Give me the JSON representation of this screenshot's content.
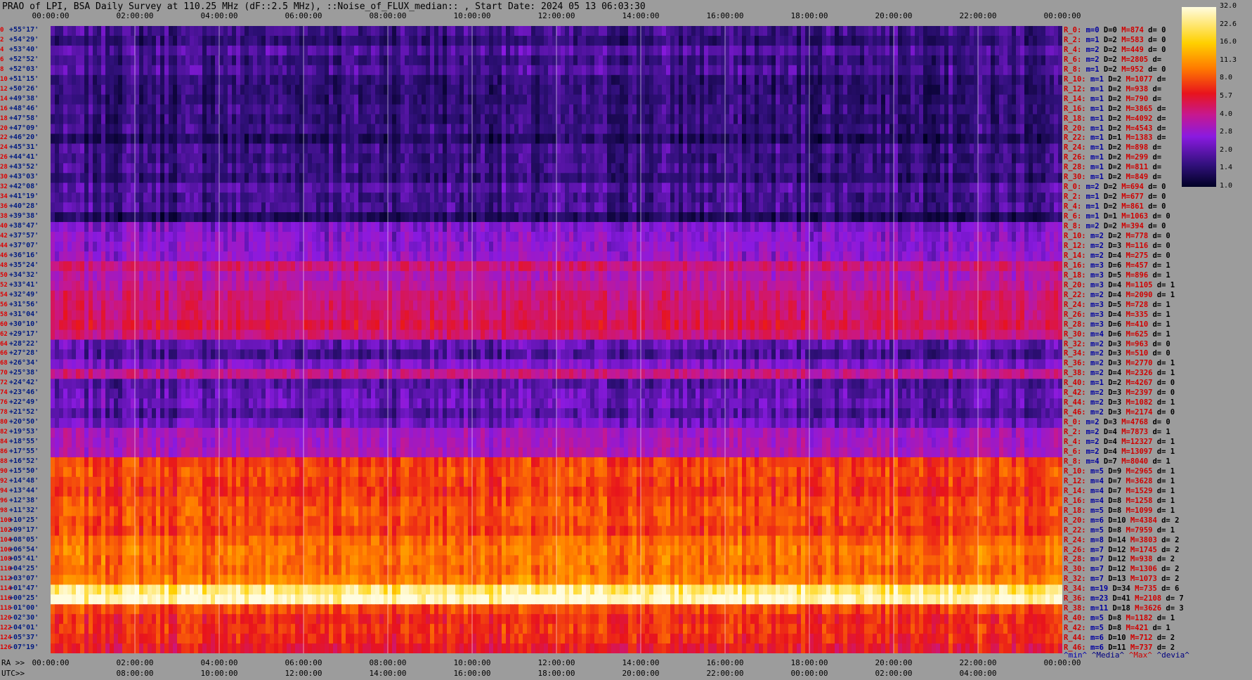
{
  "title": "PRAO of LPI, BSA Daily Survey at 110.25 MHz (dF::2.5 MHz), ::Noise_of_FLUX_median:: , Start Date: 2024 05 13 06:03:30",
  "axis_labels": {
    "ra": "RA >>",
    "utc": "UTC>>"
  },
  "top_ticks": [
    "00:00:00",
    "02:00:00",
    "04:00:00",
    "06:00:00",
    "08:00:00",
    "10:00:00",
    "12:00:00",
    "14:00:00",
    "16:00:00",
    "18:00:00",
    "20:00:00",
    "22:00:00",
    "00:00:00"
  ],
  "ra_ticks": [
    "00:00:00",
    "02:00:00",
    "04:00:00",
    "06:00:00",
    "08:00:00",
    "10:00:00",
    "12:00:00",
    "14:00:00",
    "16:00:00",
    "18:00:00",
    "20:00:00",
    "22:00:00",
    "00:00:00"
  ],
  "utc_ticks": [
    "08:00:00",
    "10:00:00",
    "12:00:00",
    "14:00:00",
    "16:00:00",
    "18:00:00",
    "20:00:00",
    "22:00:00",
    "00:00:00",
    "02:00:00",
    "04:00:00"
  ],
  "legend": {
    "min": "^min^",
    "median": "^Media^",
    "max": "^Max^",
    "dev": "^devia^"
  },
  "colorbar": {
    "ticks": [
      "32.0",
      "22.6",
      "16.0",
      "11.3",
      "8.0",
      "5.7",
      "4.0",
      "2.8",
      "2.0",
      "1.4",
      "1.0"
    ]
  },
  "chart_data": {
    "type": "heatmap",
    "colorscale": [
      "#000024",
      "#30107a",
      "#8a1ae0",
      "#c61890",
      "#e8141c",
      "#ff7b00",
      "#ffd000",
      "#fffce0"
    ],
    "value_range": [
      1.0,
      32.0
    ],
    "log_scale": true,
    "x_axis": "RA 00:00:00 – 24:00:00",
    "declinations": [
      {
        "i": "0",
        "d": "+55°17'"
      },
      {
        "i": "2",
        "d": "+54°29'"
      },
      {
        "i": "4",
        "d": "+53°40'"
      },
      {
        "i": "6",
        "d": "+52°52'"
      },
      {
        "i": "8",
        "d": "+52°03'"
      },
      {
        "i": "10",
        "d": "+51°15'"
      },
      {
        "i": "12",
        "d": "+50°26'"
      },
      {
        "i": "14",
        "d": "+49°38'"
      },
      {
        "i": "16",
        "d": "+48°46'"
      },
      {
        "i": "18",
        "d": "+47°58'"
      },
      {
        "i": "20",
        "d": "+47°09'"
      },
      {
        "i": "22",
        "d": "+46°20'"
      },
      {
        "i": "24",
        "d": "+45°31'"
      },
      {
        "i": "26",
        "d": "+44°41'"
      },
      {
        "i": "28",
        "d": "+43°52'"
      },
      {
        "i": "30",
        "d": "+43°03'"
      },
      {
        "i": "32",
        "d": "+42°08'"
      },
      {
        "i": "34",
        "d": "+41°19'"
      },
      {
        "i": "36",
        "d": "+40°28'"
      },
      {
        "i": "38",
        "d": "+39°38'"
      },
      {
        "i": "40",
        "d": "+38°47'"
      },
      {
        "i": "42",
        "d": "+37°57'"
      },
      {
        "i": "44",
        "d": "+37°07'"
      },
      {
        "i": "46",
        "d": "+36°16'"
      },
      {
        "i": "48",
        "d": "+35°24'"
      },
      {
        "i": "50",
        "d": "+34°32'"
      },
      {
        "i": "52",
        "d": "+33°41'"
      },
      {
        "i": "54",
        "d": "+32°49'"
      },
      {
        "i": "56",
        "d": "+31°56'"
      },
      {
        "i": "58",
        "d": "+31°04'"
      },
      {
        "i": "60",
        "d": "+30°10'"
      },
      {
        "i": "62",
        "d": "+29°17'"
      },
      {
        "i": "64",
        "d": "+28°22'"
      },
      {
        "i": "66",
        "d": "+27°28'"
      },
      {
        "i": "68",
        "d": "+26°34'"
      },
      {
        "i": "70",
        "d": "+25°38'"
      },
      {
        "i": "72",
        "d": "+24°42'"
      },
      {
        "i": "74",
        "d": "+23°46'"
      },
      {
        "i": "76",
        "d": "+22°49'"
      },
      {
        "i": "78",
        "d": "+21°52'"
      },
      {
        "i": "80",
        "d": "+20°50'"
      },
      {
        "i": "82",
        "d": "+19°53'"
      },
      {
        "i": "84",
        "d": "+18°55'"
      },
      {
        "i": "86",
        "d": "+17°55'"
      },
      {
        "i": "88",
        "d": "+16°52'"
      },
      {
        "i": "90",
        "d": "+15°50'"
      },
      {
        "i": "92",
        "d": "+14°48'"
      },
      {
        "i": "94",
        "d": "+13°44'"
      },
      {
        "i": "96",
        "d": "+12°38'"
      },
      {
        "i": "98",
        "d": "+11°32'"
      },
      {
        "i": "100",
        "d": "+10°25'"
      },
      {
        "i": "102",
        "d": "+09°17'"
      },
      {
        "i": "104",
        "d": "+08°05'"
      },
      {
        "i": "106",
        "d": "+06°54'"
      },
      {
        "i": "108",
        "d": "+05°41'"
      },
      {
        "i": "110",
        "d": "+04°25'"
      },
      {
        "i": "112",
        "d": "+03°07'"
      },
      {
        "i": "114",
        "d": "+01°47'"
      },
      {
        "i": "116",
        "d": "+00°25'"
      },
      {
        "i": "118",
        "d": "-01°00'"
      },
      {
        "i": "120",
        "d": "-02°30'"
      },
      {
        "i": "122",
        "d": "-04°01'"
      },
      {
        "i": "124",
        "d": "-05°37'"
      },
      {
        "i": "126",
        "d": "-07°19'"
      }
    ],
    "row_levels": [
      1.8,
      1.6,
      2.0,
      1.7,
      1.9,
      1.6,
      1.6,
      1.6,
      1.7,
      1.6,
      1.7,
      1.4,
      1.8,
      1.7,
      1.8,
      1.6,
      2.0,
      1.8,
      1.9,
      1.4,
      2.6,
      2.8,
      2.9,
      3.0,
      5.0,
      3.8,
      4.2,
      5.0,
      5.2,
      5.3,
      6.0,
      5.0,
      2.2,
      1.9,
      2.6,
      4.5,
      2.0,
      2.2,
      2.3,
      2.0,
      2.4,
      3.4,
      3.4,
      3.6,
      9.0,
      9.5,
      9.0,
      8.5,
      9.5,
      10.0,
      9.5,
      9.0,
      11.0,
      12.0,
      11.5,
      11.0,
      12.5,
      26.0,
      32.0,
      9.5,
      8.0,
      8.5,
      8.0,
      7.0
    ]
  },
  "stats": [
    {
      "r": "R_0:",
      "m": "m=0",
      "D": "D=0",
      "M": "M=874",
      "d": "d= 0"
    },
    {
      "r": "R_2:",
      "m": "m=1",
      "D": "D=2",
      "M": "M=583",
      "d": "d= 0"
    },
    {
      "r": "R_4:",
      "m": "m=2",
      "D": "D=2",
      "M": "M=449",
      "d": "d= 0"
    },
    {
      "r": "R_6:",
      "m": "m=2",
      "D": "D=2",
      "M": "M=2805",
      "d": "d="
    },
    {
      "r": "R_8:",
      "m": "m=1",
      "D": "D=2",
      "M": "M=952",
      "d": "d= 0"
    },
    {
      "r": "R_10:",
      "m": "m=1",
      "D": "D=2",
      "M": "M=1077",
      "d": "d="
    },
    {
      "r": "R_12:",
      "m": "m=1",
      "D": "D=2",
      "M": "M=938",
      "d": "d="
    },
    {
      "r": "R_14:",
      "m": "m=1",
      "D": "D=2",
      "M": "M=790",
      "d": "d="
    },
    {
      "r": "R_16:",
      "m": "m=1",
      "D": "D=2",
      "M": "M=3865",
      "d": "d="
    },
    {
      "r": "R_18:",
      "m": "m=1",
      "D": "D=2",
      "M": "M=4092",
      "d": "d="
    },
    {
      "r": "R_20:",
      "m": "m=1",
      "D": "D=2",
      "M": "M=4543",
      "d": "d="
    },
    {
      "r": "R_22:",
      "m": "m=1",
      "D": "D=1",
      "M": "M=1383",
      "d": "d="
    },
    {
      "r": "R_24:",
      "m": "m=1",
      "D": "D=2",
      "M": "M=898",
      "d": "d="
    },
    {
      "r": "R_26:",
      "m": "m=1",
      "D": "D=2",
      "M": "M=299",
      "d": "d="
    },
    {
      "r": "R_28:",
      "m": "m=1",
      "D": "D=2",
      "M": "M=811",
      "d": "d="
    },
    {
      "r": "R_30:",
      "m": "m=1",
      "D": "D=2",
      "M": "M=849",
      "d": "d="
    },
    {
      "r": "R_0:",
      "m": "m=2",
      "D": "D=2",
      "M": "M=694",
      "d": "d= 0"
    },
    {
      "r": "R_2:",
      "m": "m=1",
      "D": "D=2",
      "M": "M=677",
      "d": "d= 0"
    },
    {
      "r": "R_4:",
      "m": "m=1",
      "D": "D=2",
      "M": "M=861",
      "d": "d= 0"
    },
    {
      "r": "R_6:",
      "m": "m=1",
      "D": "D=1",
      "M": "M=1063",
      "d": "d= 0"
    },
    {
      "r": "R_8:",
      "m": "m=2",
      "D": "D=2",
      "M": "M=394",
      "d": "d= 0"
    },
    {
      "r": "R_10:",
      "m": "m=2",
      "D": "D=2",
      "M": "M=778",
      "d": "d= 0"
    },
    {
      "r": "R_12:",
      "m": "m=2",
      "D": "D=3",
      "M": "M=116",
      "d": "d= 0"
    },
    {
      "r": "R_14:",
      "m": "m=2",
      "D": "D=4",
      "M": "M=275",
      "d": "d= 0"
    },
    {
      "r": "R_16:",
      "m": "m=3",
      "D": "D=6",
      "M": "M=457",
      "d": "d= 1"
    },
    {
      "r": "R_18:",
      "m": "m=3",
      "D": "D=5",
      "M": "M=896",
      "d": "d= 1"
    },
    {
      "r": "R_20:",
      "m": "m=3",
      "D": "D=4",
      "M": "M=1105",
      "d": "d= 1"
    },
    {
      "r": "R_22:",
      "m": "m=2",
      "D": "D=4",
      "M": "M=2090",
      "d": "d= 1"
    },
    {
      "r": "R_24:",
      "m": "m=3",
      "D": "D=5",
      "M": "M=728",
      "d": "d= 1"
    },
    {
      "r": "R_26:",
      "m": "m=3",
      "D": "D=4",
      "M": "M=335",
      "d": "d= 1"
    },
    {
      "r": "R_28:",
      "m": "m=3",
      "D": "D=6",
      "M": "M=410",
      "d": "d= 1"
    },
    {
      "r": "R_30:",
      "m": "m=4",
      "D": "D=6",
      "M": "M=625",
      "d": "d= 1"
    },
    {
      "r": "R_32:",
      "m": "m=2",
      "D": "D=3",
      "M": "M=963",
      "d": "d= 0"
    },
    {
      "r": "R_34:",
      "m": "m=2",
      "D": "D=3",
      "M": "M=510",
      "d": "d= 0"
    },
    {
      "r": "R_36:",
      "m": "m=2",
      "D": "D=3",
      "M": "M=2770",
      "d": "d= 1"
    },
    {
      "r": "R_38:",
      "m": "m=2",
      "D": "D=4",
      "M": "M=2326",
      "d": "d= 1"
    },
    {
      "r": "R_40:",
      "m": "m=1",
      "D": "D=2",
      "M": "M=4267",
      "d": "d= 0"
    },
    {
      "r": "R_42:",
      "m": "m=2",
      "D": "D=3",
      "M": "M=2397",
      "d": "d= 0"
    },
    {
      "r": "R_44:",
      "m": "m=2",
      "D": "D=3",
      "M": "M=1082",
      "d": "d= 1"
    },
    {
      "r": "R_46:",
      "m": "m=2",
      "D": "D=3",
      "M": "M=2174",
      "d": "d= 0"
    },
    {
      "r": "R_0:",
      "m": "m=2",
      "D": "D=3",
      "M": "M=4768",
      "d": "d= 0"
    },
    {
      "r": "R_2:",
      "m": "m=2",
      "D": "D=4",
      "M": "M=7873",
      "d": "d= 1"
    },
    {
      "r": "R_4:",
      "m": "m=2",
      "D": "D=4",
      "M": "M=12327",
      "d": "d= 1"
    },
    {
      "r": "R_6:",
      "m": "m=2",
      "D": "D=4",
      "M": "M=13097",
      "d": "d= 1"
    },
    {
      "r": "R_8:",
      "m": "m=4",
      "D": "D=7",
      "M": "M=8040",
      "d": "d= 1"
    },
    {
      "r": "R_10:",
      "m": "m=5",
      "D": "D=9",
      "M": "M=2965",
      "d": "d= 1"
    },
    {
      "r": "R_12:",
      "m": "m=4",
      "D": "D=7",
      "M": "M=3628",
      "d": "d= 1"
    },
    {
      "r": "R_14:",
      "m": "m=4",
      "D": "D=7",
      "M": "M=1529",
      "d": "d= 1"
    },
    {
      "r": "R_16:",
      "m": "m=4",
      "D": "D=8",
      "M": "M=1258",
      "d": "d= 1"
    },
    {
      "r": "R_18:",
      "m": "m=5",
      "D": "D=8",
      "M": "M=1099",
      "d": "d= 1"
    },
    {
      "r": "R_20:",
      "m": "m=6",
      "D": "D=10",
      "M": "M=4384",
      "d": "d= 2"
    },
    {
      "r": "R_22:",
      "m": "m=5",
      "D": "D=8",
      "M": "M=7959",
      "d": "d= 1"
    },
    {
      "r": "R_24:",
      "m": "m=8",
      "D": "D=14",
      "M": "M=3803",
      "d": "d= 2"
    },
    {
      "r": "R_26:",
      "m": "m=7",
      "D": "D=12",
      "M": "M=1745",
      "d": "d= 2"
    },
    {
      "r": "R_28:",
      "m": "m=7",
      "D": "D=12",
      "M": "M=938",
      "d": "d= 2"
    },
    {
      "r": "R_30:",
      "m": "m=7",
      "D": "D=12",
      "M": "M=1306",
      "d": "d= 2"
    },
    {
      "r": "R_32:",
      "m": "m=7",
      "D": "D=13",
      "M": "M=1073",
      "d": "d= 2"
    },
    {
      "r": "R_34:",
      "m": "m=19",
      "D": "D=34",
      "M": "M=735",
      "d": "d= 6"
    },
    {
      "r": "R_36:",
      "m": "m=23",
      "D": "D=41",
      "M": "M=2108",
      "d": "d= 7"
    },
    {
      "r": "R_38:",
      "m": "m=11",
      "D": "D=18",
      "M": "M=3626",
      "d": "d= 3"
    },
    {
      "r": "R_40:",
      "m": "m=5",
      "D": "D=8",
      "M": "M=1182",
      "d": "d= 1"
    },
    {
      "r": "R_42:",
      "m": "m=5",
      "D": "D=8",
      "M": "M=421",
      "d": "d= 1"
    },
    {
      "r": "R_44:",
      "m": "m=6",
      "D": "D=10",
      "M": "M=712",
      "d": "d= 2"
    },
    {
      "r": "R_46:",
      "m": "m=6",
      "D": "D=11",
      "M": "M=737",
      "d": "d= 2"
    }
  ]
}
